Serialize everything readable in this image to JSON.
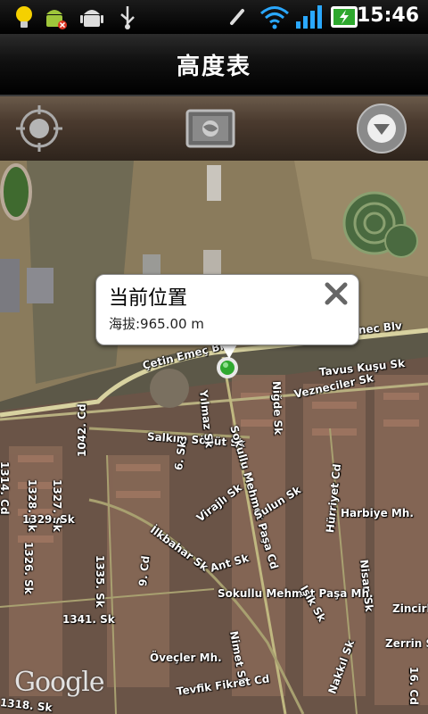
{
  "status_bar": {
    "time": "15:46",
    "icons": [
      "lightbulb-icon",
      "android-debug-icon",
      "android-icon",
      "usb-icon",
      "vibrate-icon",
      "wifi-icon",
      "signal-icon",
      "battery-charging-icon"
    ]
  },
  "header": {
    "title": "高度表"
  },
  "toolbar": {
    "buttons": [
      "locate-icon",
      "map-view-icon",
      "menu-down-icon"
    ]
  },
  "popup": {
    "title": "当前位置",
    "altitude": "海拔:965.00 m"
  },
  "map": {
    "attribution": "Google",
    "streets": [
      "Çetin Emeç Blv",
      "nec Blv",
      "Salkım Söğüt Sk",
      "Sokullu Mehmet Paşa Cd",
      "Tavus Kuşu Sk",
      "Vezneciler Sk",
      "Niğde Sk",
      "Yılmaz Sk",
      "1314. Cd",
      "1328. Sk",
      "1327. Sk",
      "1042. Cd",
      "1329. Sk",
      "1326. Sk",
      "1335. Sk",
      "1341. Sk",
      "1318. Sk",
      "Sulun Sk",
      "Virajlı Sk",
      "İlkbahar Sk",
      "Ant Sk",
      "Hürriyet Cd",
      "Harbiye Mh.",
      "Nisan Sk",
      "Zincirli",
      "Zerrin Sk",
      "Sokullu Mehmet Paşa Mh.",
      "Nimet Sk",
      "Öveçler Mh.",
      "Tevfik Fikret Cd",
      "Nakkıl Sk",
      "6. Sk",
      "9. Cd",
      "16. Cd",
      "Işık Sk"
    ]
  }
}
